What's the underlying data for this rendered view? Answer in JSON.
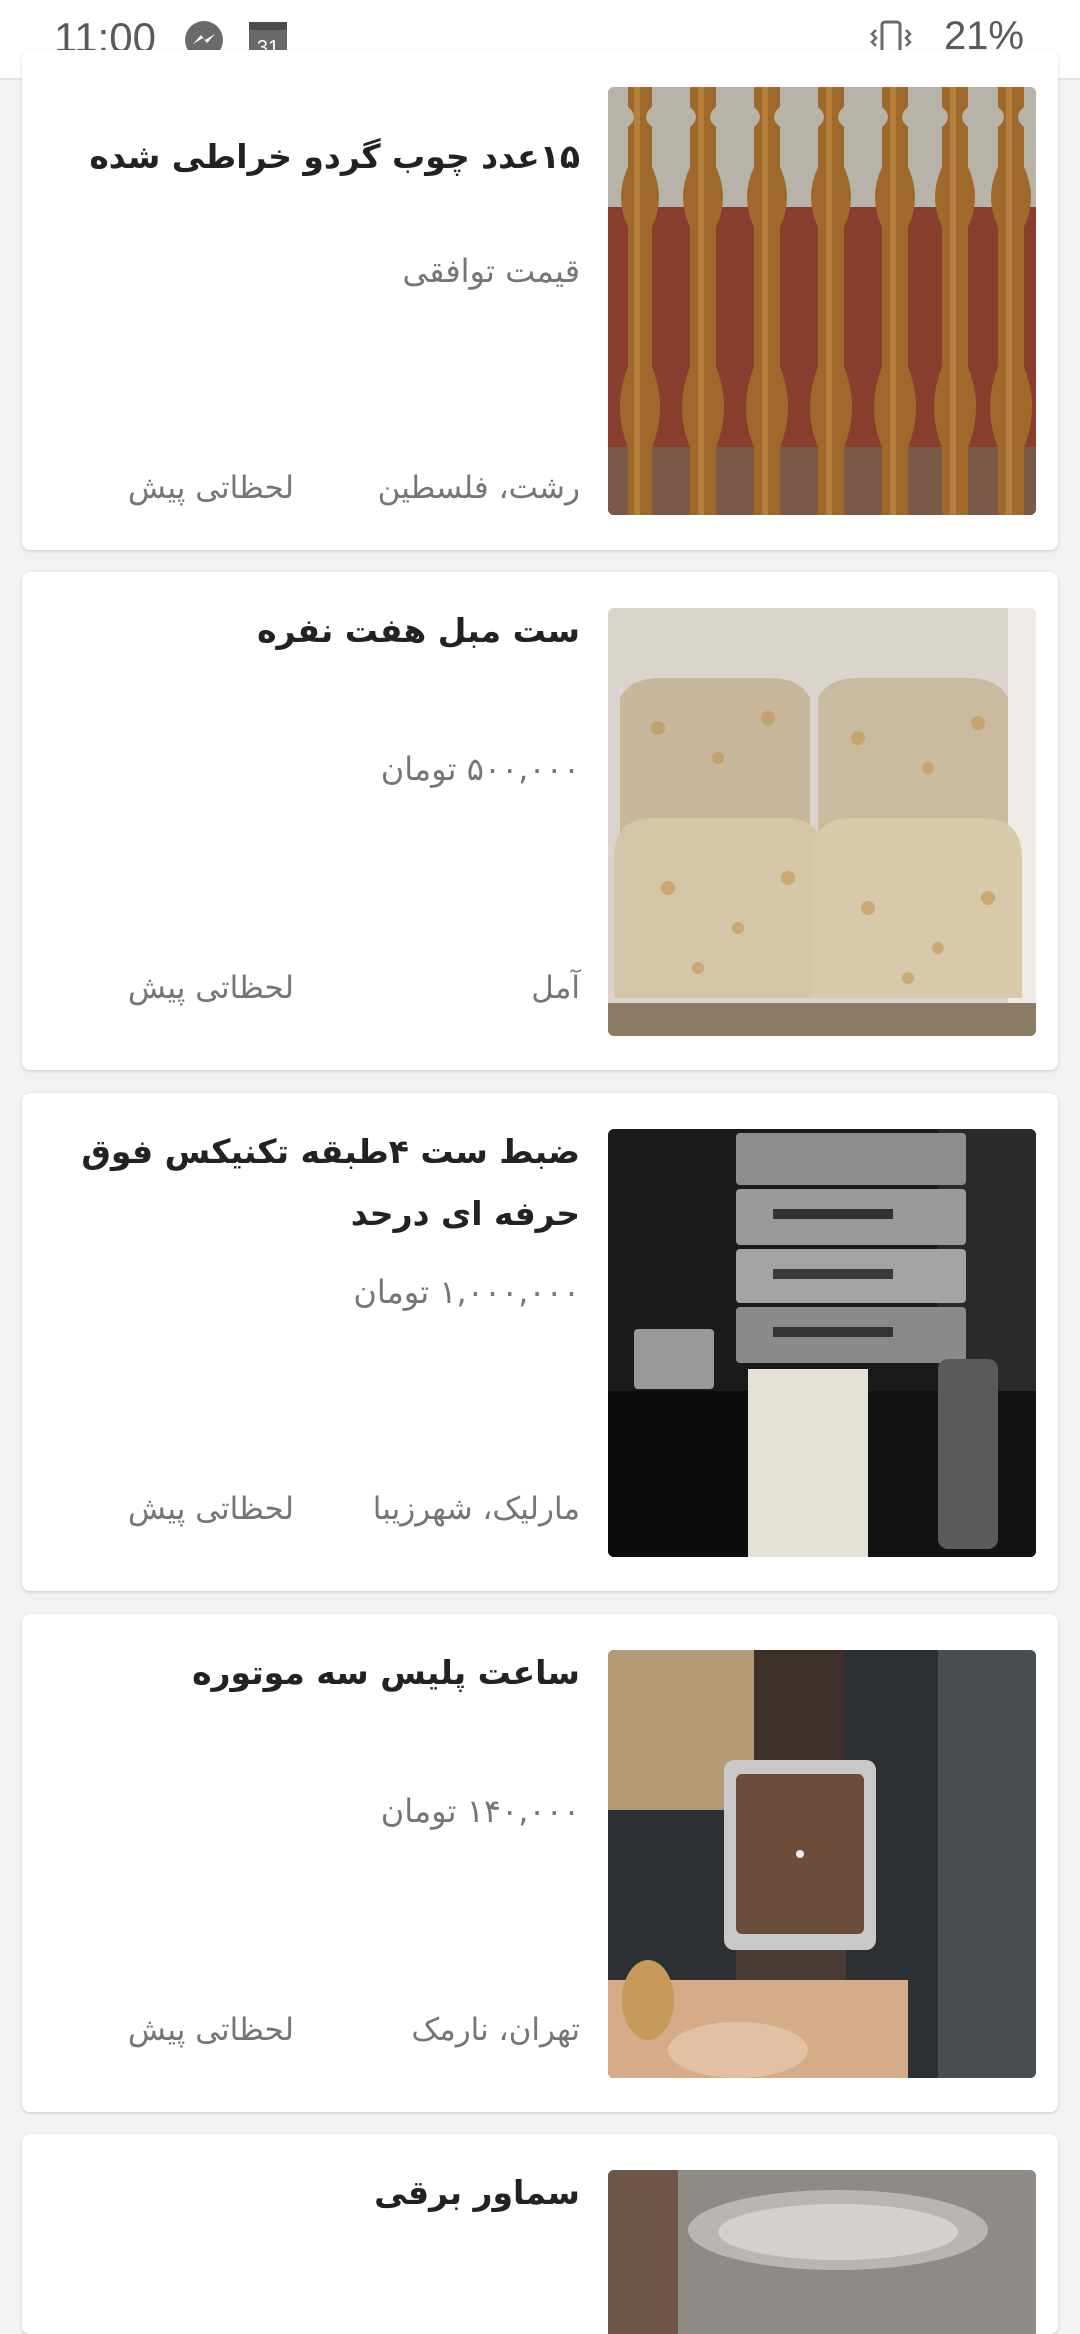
{
  "status_bar": {
    "time": "11:00",
    "icons": [
      "messenger-icon",
      "calendar-icon"
    ],
    "calendar_day": "31",
    "battery": "21%",
    "vibrate_icon": "vibrate-icon"
  },
  "ads": [
    {
      "title": "۱۵عدد چوب گردو خراطی شده",
      "price": "قیمت توافقی",
      "location": "رشت، فلسطین",
      "time": "لحظاتی پیش",
      "image": "wooden-balusters"
    },
    {
      "title": "ست مبل هفت نفره",
      "price": "۵۰۰,۰۰۰ تومان",
      "location": "آمل",
      "time": "لحظاتی پیش",
      "image": "sofa-set"
    },
    {
      "title": "ضبط ست ۴طبقه تکنیکس فوق حرفه ای درحد",
      "price": "۱,۰۰۰,۰۰۰ تومان",
      "location": "مارلیک، شهرزیبا",
      "time": "لحظاتی پیش",
      "image": "stereo-system"
    },
    {
      "title": "ساعت پلیس سه موتوره",
      "price": "۱۴۰,۰۰۰ تومان",
      "location": "تهران، نارمک",
      "time": "لحظاتی پیش",
      "image": "wristwatch"
    },
    {
      "title": "سماور برقی",
      "image": "electric-samovar"
    }
  ]
}
